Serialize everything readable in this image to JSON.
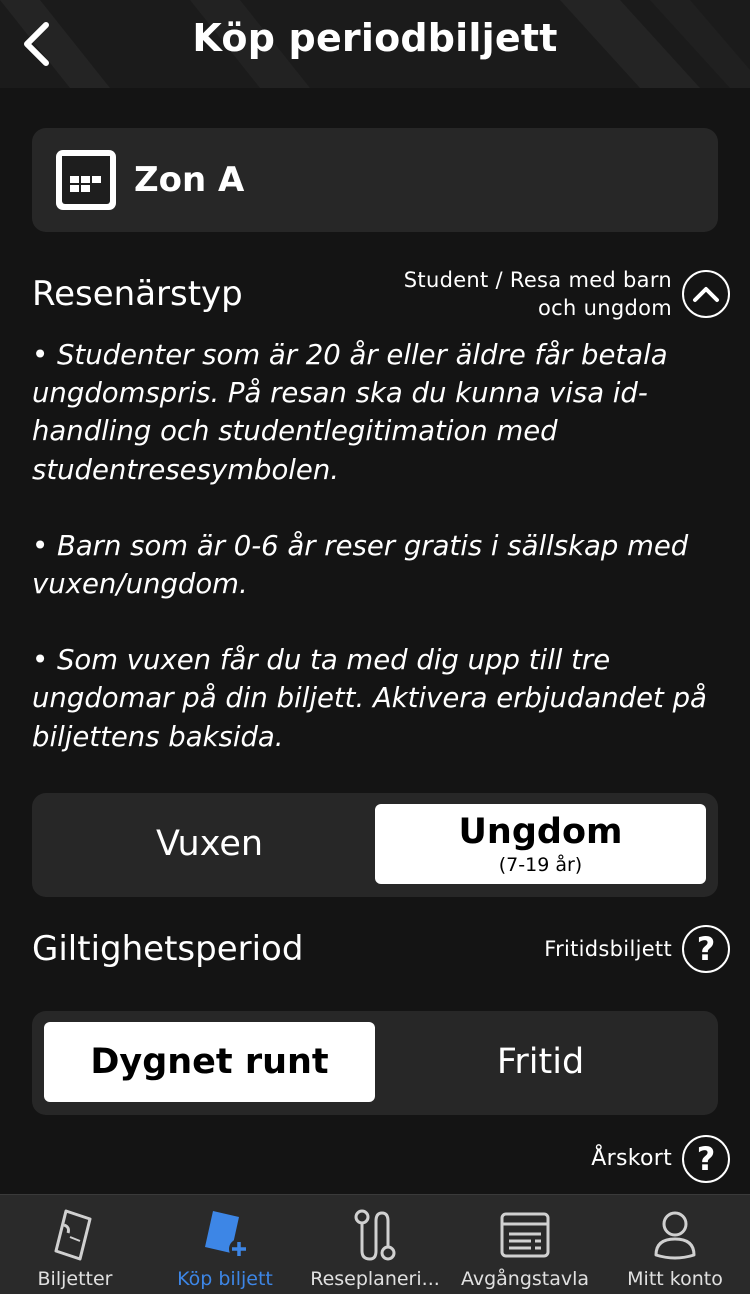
{
  "header": {
    "title": "Köp periodbiljett",
    "back_icon": "chevron-left-icon"
  },
  "zone": {
    "label": "Zon A",
    "icon": "calendar-icon"
  },
  "traveler_type": {
    "title": "Resenärstyp",
    "toggle_line1": "Student / Resa med barn",
    "toggle_line2": "och ungdom",
    "toggle_icon": "chevron-up-circle-icon",
    "info": [
      "• Studenter som är 20 år eller äldre får betala ungdomspris. På resan ska du kunna visa id-handling och studentlegitimation med studentresesymbolen.",
      "• Barn som är 0-6 år reser gratis i sällskap med vuxen/ungdom.",
      "• Som vuxen får du ta med dig upp till tre ungdomar på din biljett. Aktivera erbjudandet på biljettens baksida."
    ],
    "options": [
      {
        "label": "Vuxen",
        "sub": "",
        "selected": false
      },
      {
        "label": "Ungdom",
        "sub": "(7-19 år)",
        "selected": true
      }
    ]
  },
  "validity": {
    "title": "Giltighetsperiod",
    "help_label": "Fritidsbiljett",
    "help_icon": "question-circle-icon",
    "options": [
      {
        "label": "Dygnet runt",
        "selected": true
      },
      {
        "label": "Fritid",
        "selected": false
      }
    ]
  },
  "annual": {
    "label": "Årskort",
    "icon": "question-circle-icon"
  },
  "bottom_nav": {
    "items": [
      {
        "label": "Biljetter",
        "icon": "ticket-icon",
        "active": false
      },
      {
        "label": "Köp biljett",
        "icon": "buy-ticket-icon",
        "active": true
      },
      {
        "label": "Reseplaneri...",
        "icon": "route-icon",
        "active": false
      },
      {
        "label": "Avgångstavla",
        "icon": "departure-board-icon",
        "active": false
      },
      {
        "label": "Mitt konto",
        "icon": "user-icon",
        "active": false
      }
    ]
  },
  "colors": {
    "background": "#141414",
    "card": "#272727",
    "accent": "#3d86e6",
    "text": "#ffffff"
  }
}
